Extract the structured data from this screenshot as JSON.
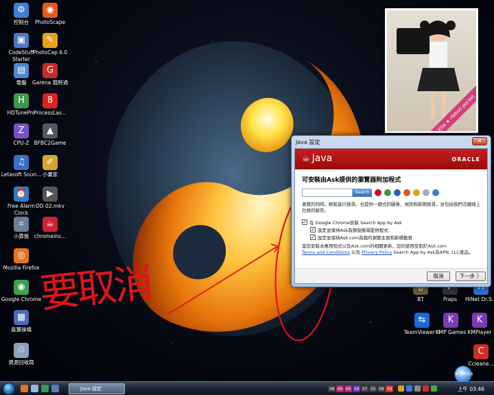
{
  "desktop": {
    "icons_left": [
      {
        "label": "控制台",
        "icon": "control-panel-icon",
        "color": "#3d7fd8",
        "glyph": "⚙"
      },
      {
        "label": "PhotoScape",
        "icon": "photoscape-icon",
        "color": "#e65a1d",
        "glyph": "◉"
      },
      {
        "label": "CodeStuff Starter",
        "icon": "codestuff-icon",
        "color": "#4a78c2",
        "glyph": "▣"
      },
      {
        "label": "PhotoCap 6.0",
        "icon": "photocap-icon",
        "color": "#e6a21d",
        "glyph": "✎"
      },
      {
        "label": "電腦",
        "icon": "computer-icon",
        "color": "#4b88d6",
        "glyph": "▤"
      },
      {
        "label": "Garena 競時通",
        "icon": "garena-icon",
        "color": "#c92b2b",
        "glyph": "G"
      },
      {
        "label": "HDTunePro",
        "icon": "hdtune-icon",
        "color": "#3c9a4a",
        "glyph": "H"
      },
      {
        "label": "ProcessLas...",
        "icon": "processlasso-icon",
        "color": "#d22",
        "glyph": "8"
      },
      {
        "label": "CPU-Z",
        "icon": "cpuz-icon",
        "color": "#7b4fc9",
        "glyph": "Z"
      },
      {
        "label": "BFBC2Game",
        "icon": "bfbc2-icon",
        "color": "#556",
        "glyph": "▲"
      },
      {
        "label": "Letasoft Soun...",
        "icon": "letasoft-icon",
        "color": "#3a6fc7",
        "glyph": "♫"
      },
      {
        "label": "小畫家",
        "icon": "paint-icon",
        "color": "#d6a42b",
        "glyph": "✐"
      },
      {
        "label": "Free Alarm Clock",
        "icon": "alarm-clock-icon",
        "color": "#2a7fcf",
        "glyph": "⏰"
      },
      {
        "label": "DD 02.mkv",
        "icon": "video-file-icon",
        "color": "#555",
        "glyph": "▶"
      },
      {
        "label": "小算盤",
        "icon": "calculator-icon",
        "color": "#6a7f9a",
        "glyph": "⌗"
      },
      {
        "label": "chromeins...",
        "icon": "java-file-icon",
        "color": "#c23",
        "glyph": "☕"
      },
      {
        "label": "Mozilla Firefox",
        "icon": "firefox-icon",
        "color": "#e8731c",
        "glyph": "◎"
      },
      {
        "label": "Google Chrome",
        "icon": "chrome-icon",
        "color": "#3aa24a",
        "glyph": "◉"
      },
      {
        "label": "嘉獲操檔",
        "icon": "record-icon",
        "color": "#4a6bb8",
        "glyph": "▦"
      },
      {
        "label": "資源回收筒",
        "icon": "recycle-bin-icon",
        "color": "#8aa2bd",
        "glyph": "♲"
      }
    ],
    "icons_right": [
      {
        "label": "BT",
        "icon": "bt-icon",
        "color": "#6b5a3a",
        "glyph": "▯"
      },
      {
        "label": "Fraps",
        "icon": "fraps-icon",
        "color": "#333",
        "glyph": "F"
      },
      {
        "label": "HiNet Dr.S...",
        "icon": "hinet-icon",
        "color": "#2a6fd0",
        "glyph": "H"
      },
      {
        "label": "TeamViewer 9",
        "icon": "teamviewer-icon",
        "color": "#1a6ad8",
        "glyph": "⇆"
      },
      {
        "label": "KMP Games",
        "icon": "kmp-games-icon",
        "color": "#7a3bb5",
        "glyph": "K"
      },
      {
        "label": "KMPlayer",
        "icon": "kmplayer-icon",
        "color": "#7a3bb5",
        "glyph": "K"
      },
      {
        "label": "Ccleane...",
        "icon": "ccleaner-icon",
        "color": "#c8302a",
        "glyph": "C"
      }
    ],
    "photo_ribbon": "Kite ★ ribbon pocket"
  },
  "annotation": {
    "handwritten_text": "要取消",
    "color": "#e0141a"
  },
  "dialog": {
    "title": "Java 設定",
    "close_glyph": "✕",
    "brand": "Java",
    "vendor": "ORACLE",
    "heading": "可安裝由Ask提供的瀏覽器附加程式",
    "search_button": "Search",
    "description": "瀏覽的同時，輕鬆進行搜尋。也提供一鍵式的圖像、視訊和新聞搜尋，並包括我們活躍線上社群的解答。",
    "checkbox_main": "在 Google Chrome安裝 Search App by Ask",
    "checkbox_sub1": "設定並保持Ask為預設搜尋提供程式",
    "checkbox_sub2": "設定並保持Ask.com為我的瀏覽主頁和新標籤頁",
    "footer_text": "當您安裝本應用程式以及Ask.com的相關更新，您的使用受制於Ask.com",
    "terms_link": "Terms and Conditions",
    "and_text": "以及",
    "privacy_link": "Privacy Policy",
    "footer_tail": "Search App by Ask為APN, LLC產品。",
    "cancel_label": "取消",
    "next_label": "下一步 〉"
  },
  "taskbar": {
    "task_label": "Java 設定",
    "tray_numbers": [
      {
        "value": "38",
        "color": "#3a3a3a"
      },
      {
        "value": "45",
        "color": "#b02a6b"
      },
      {
        "value": "45",
        "color": "#b02a6b"
      },
      {
        "value": "39",
        "color": "#6a2ab0"
      },
      {
        "value": "37",
        "color": "#3a3a3a"
      },
      {
        "value": "35",
        "color": "#3a3a3a"
      },
      {
        "value": "38",
        "color": "#3a3a3a"
      },
      {
        "value": "39",
        "color": "#c9302a"
      }
    ],
    "clock": "上午 03:46",
    "net_speed": "43.6KB/s"
  }
}
